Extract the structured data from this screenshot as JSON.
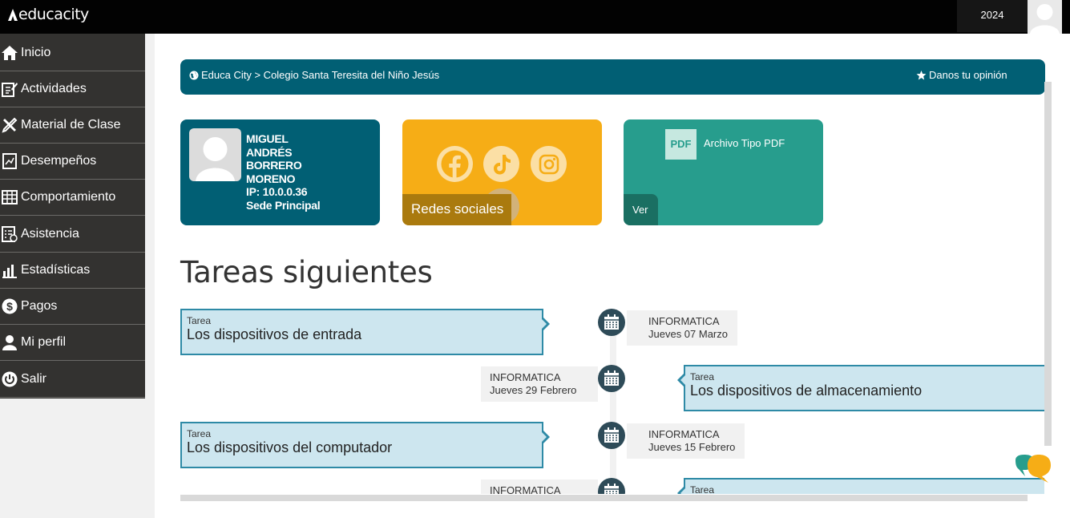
{
  "header": {
    "logo_text": "educacity",
    "year": "2024"
  },
  "sidebar": {
    "items": [
      {
        "label": "Inicio",
        "icon": "home-icon"
      },
      {
        "label": "Actividades",
        "icon": "edit-icon"
      },
      {
        "label": "Material de Clase",
        "icon": "tools-icon"
      },
      {
        "label": "Desempeños",
        "icon": "report-icon"
      },
      {
        "label": "Comportamiento",
        "icon": "table-icon"
      },
      {
        "label": "Asistencia",
        "icon": "checklist-icon"
      },
      {
        "label": "Estadísticas",
        "icon": "bar-chart-icon"
      },
      {
        "label": "Pagos",
        "icon": "dollar-icon"
      },
      {
        "label": "Mi perfil",
        "icon": "user-icon"
      },
      {
        "label": "Salir",
        "icon": "power-icon"
      }
    ]
  },
  "breadcrumb": {
    "path": "Educa City > Colegio Santa Teresita del Niño Jesús",
    "opinion": "Danos tu opinión",
    "bg_color": "#015f74"
  },
  "profile": {
    "first_name": "MIGUEL",
    "middle_name": "ANDRÉS",
    "last_name1": "BORRERO",
    "last_name2": "MORENO",
    "ip": "IP: 10.0.0.36",
    "sede": "Sede Principal"
  },
  "social": {
    "label": "Redes sociales",
    "icons": [
      "facebook-icon",
      "tiktok-icon",
      "instagram-icon",
      "youtube-icon"
    ]
  },
  "pdf": {
    "badge": "PDF",
    "title": "Archivo Tipo PDF",
    "view_label": "Ver"
  },
  "section": {
    "title": "Tareas siguientes"
  },
  "tasks": [
    {
      "type": "Tarea",
      "title": "Los dispositivos de entrada",
      "subject": "INFORMATICA",
      "date": "Jueves 07 Marzo"
    },
    {
      "type": "Tarea",
      "title": "Los dispositivos de almacenamiento",
      "subject": "INFORMATICA",
      "date": "Jueves 29 Febrero"
    },
    {
      "type": "Tarea",
      "title": "Los dispositivos del computador",
      "subject": "INFORMATICA",
      "date": "Jueves 15 Febrero"
    },
    {
      "type": "Tarea",
      "title": "",
      "subject": "INFORMATICA",
      "date": ""
    }
  ],
  "colors": {
    "teal_dark": "#015f74",
    "yellow": "#f6ad16",
    "green": "#279d8d",
    "task_bg": "#cde6ef",
    "task_border": "#2e8aa6"
  }
}
